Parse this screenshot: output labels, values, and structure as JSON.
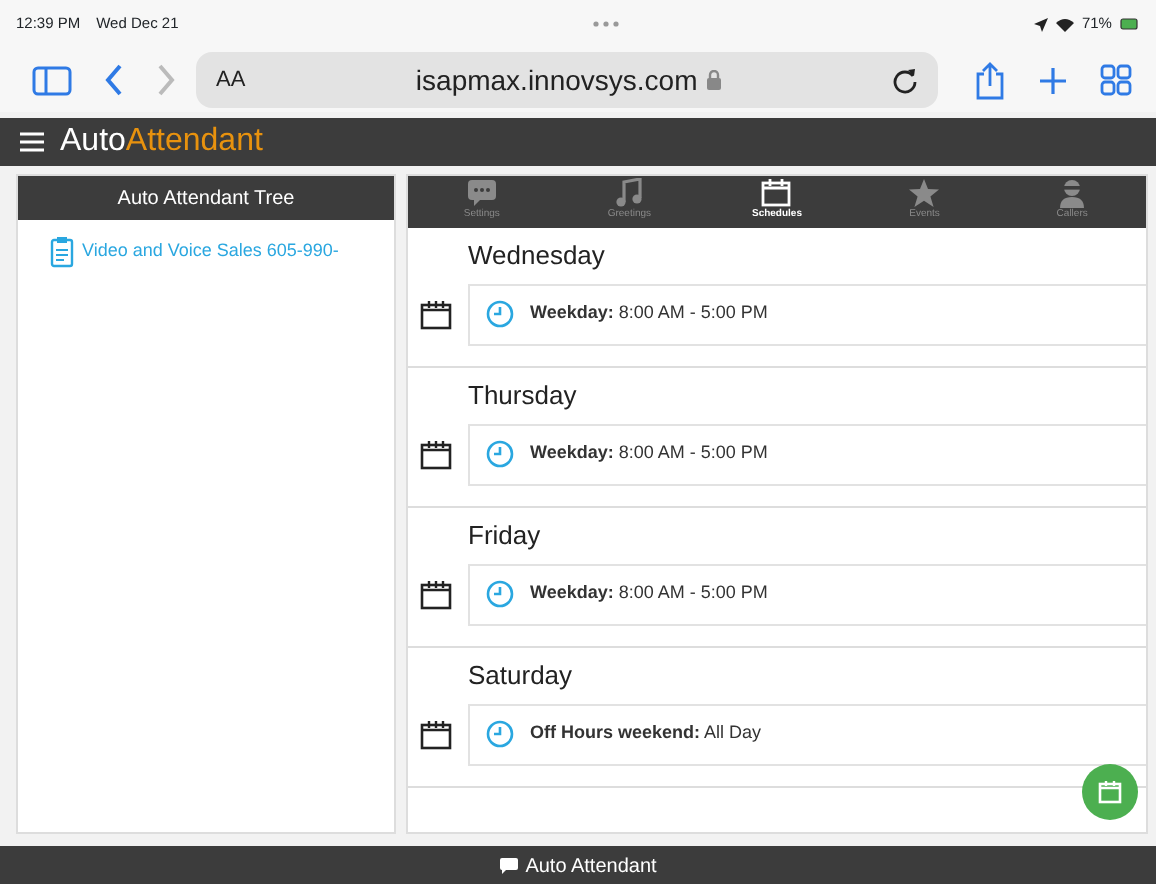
{
  "status_bar": {
    "time": "12:39 PM",
    "date": "Wed Dec 21",
    "battery": "71%"
  },
  "browser": {
    "text_size": "AA",
    "address": "isapmax.innovsys.com"
  },
  "app": {
    "title_part1": "Auto",
    "title_part2": "Attendant"
  },
  "tree": {
    "header": "Auto Attendant Tree",
    "items": [
      {
        "label": "Video and Voice Sales 605-990-"
      }
    ]
  },
  "tabs": [
    {
      "kind": "settings",
      "label": "Settings",
      "selected": false
    },
    {
      "kind": "greetings",
      "label": "Greetings",
      "selected": false
    },
    {
      "kind": "schedules",
      "label": "Schedules",
      "selected": true
    },
    {
      "kind": "events",
      "label": "Events",
      "selected": false
    },
    {
      "kind": "callers",
      "label": "Callers",
      "selected": false
    }
  ],
  "schedule": [
    {
      "day": "Wednesday",
      "entries": [
        {
          "name": "Weekday:",
          "time": "8:00 AM - 5:00 PM"
        }
      ]
    },
    {
      "day": "Thursday",
      "entries": [
        {
          "name": "Weekday:",
          "time": "8:00 AM - 5:00 PM"
        }
      ]
    },
    {
      "day": "Friday",
      "entries": [
        {
          "name": "Weekday:",
          "time": "8:00 AM - 5:00 PM"
        }
      ]
    },
    {
      "day": "Saturday",
      "entries": [
        {
          "name": "Off Hours weekend:",
          "time": "All Day"
        }
      ]
    }
  ],
  "footer": {
    "label": "Auto Attendant"
  }
}
